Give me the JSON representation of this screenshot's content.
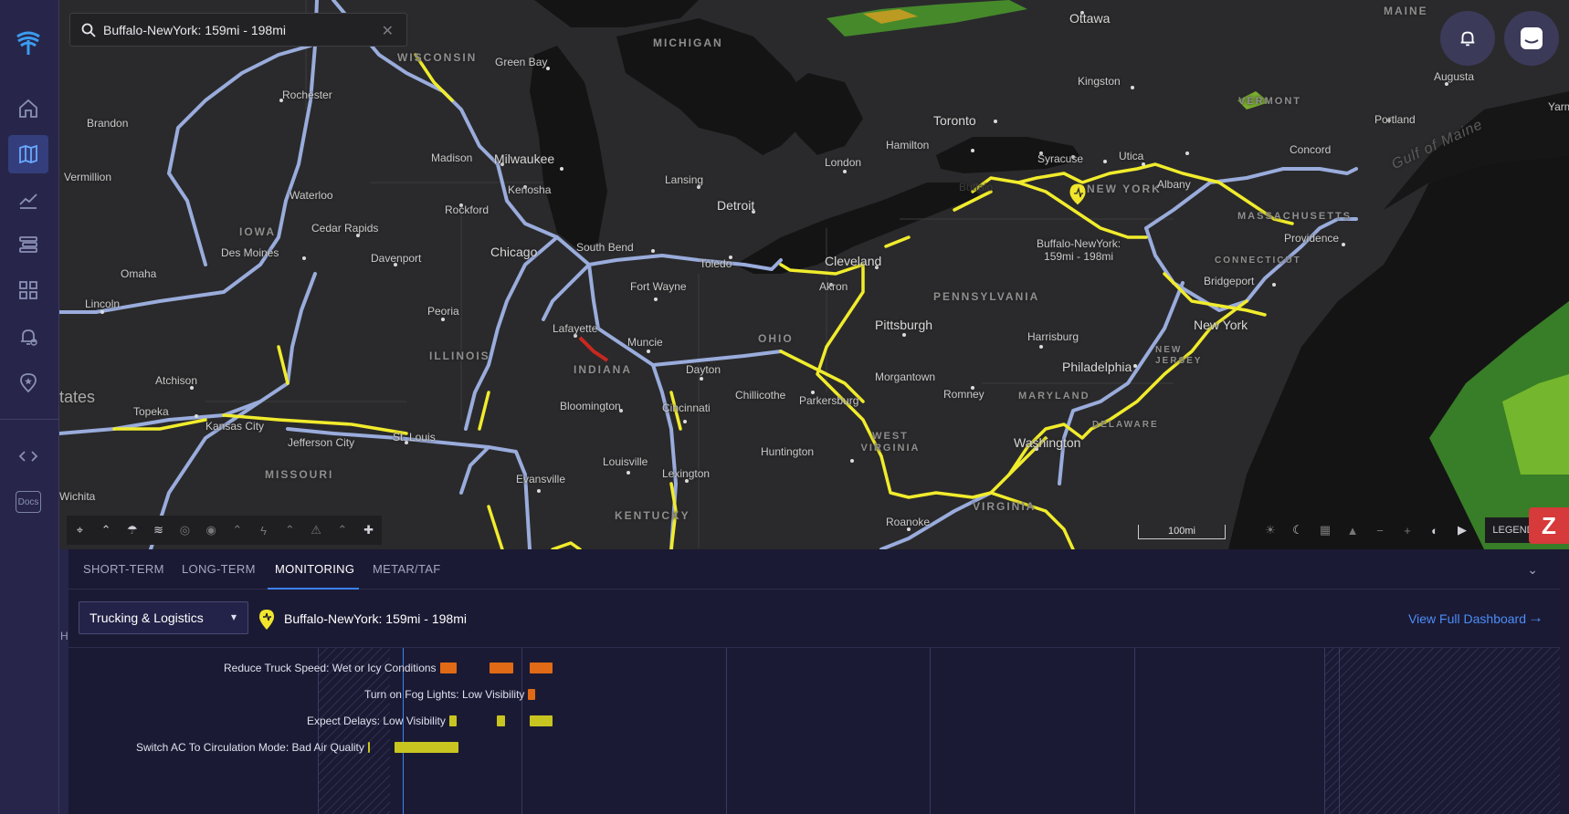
{
  "search": {
    "value": "Buffalo-NewYork: 159mi - 198mi"
  },
  "sidebar": {
    "items": [
      {
        "name": "home-icon"
      },
      {
        "name": "map-icon",
        "active": true
      },
      {
        "name": "chart-icon"
      },
      {
        "name": "layers-icon"
      },
      {
        "name": "dashboard-icon"
      },
      {
        "name": "alert-settings-icon"
      },
      {
        "name": "location-star-icon"
      },
      {
        "name": "code-icon"
      }
    ],
    "docs_label": "Docs"
  },
  "map": {
    "labels": {
      "states": [
        "WISCONSIN",
        "MICHIGAN",
        "IOWA",
        "ILLINOIS",
        "INDIANA",
        "OHIO",
        "PENNSYLVANIA",
        "NEW YORK",
        "MASSACHUSETTS",
        "CONNECTICUT",
        "NEW JERSEY",
        "MARYLAND",
        "DELAWARE",
        "WEST VIRGINIA",
        "VIRGINIA",
        "KENTUCKY",
        "MISSOURI",
        "VERMONT",
        "MAINE"
      ],
      "cities": [
        "Ottawa",
        "Green Bay",
        "Kingston",
        "Augusta",
        "Portland",
        "Rochester",
        "Brandon",
        "Vermillion",
        "Madison",
        "Milwaukee",
        "Toronto",
        "Hamilton",
        "Concord",
        "Kenosha",
        "London",
        "Lansing",
        "Syracuse",
        "Utica",
        "Albany",
        "Waterloo",
        "Rockford",
        "Detroit",
        "Buffalo",
        "Cedar Rapids",
        "Des Moines",
        "Omaha",
        "Davenport",
        "Chicago",
        "South Bend",
        "Toledo",
        "Cleveland",
        "Providence",
        "Fort Wayne",
        "Akron",
        "Bridgeport",
        "Lincoln",
        "Peoria",
        "Lafayette",
        "Muncie",
        "Pittsburgh",
        "New York",
        "Harrisburg",
        "Philadelphia",
        "Dayton",
        "Atchison",
        "Morgantown",
        "Chillicothe",
        "Parkersburg",
        "Romney",
        "Topeka",
        "Bloomington",
        "Cincinnati",
        "Kansas City",
        "St. Louis",
        "Jefferson City",
        "Huntington",
        "Washington",
        "Louisville",
        "Lexington",
        "Evansville",
        "Roanoke",
        "Wichita",
        "Yarm"
      ],
      "country_fragment": "tates",
      "water": "Gulf of Maine",
      "marker_label": [
        "Buffalo-NewYork:",
        "159mi - 198mi"
      ]
    },
    "scale_label": "100mi",
    "legend_label": "LEGEND"
  },
  "panel": {
    "tabs": [
      "SHORT-TERM",
      "LONG-TERM",
      "MONITORING",
      "METAR/TAF"
    ],
    "active_tab": "MONITORING",
    "industry_select": "Trucking & Logistics",
    "location_name": "Buffalo-NewYork: 159mi - 198mi",
    "dashboard_link": "View Full Dashboard",
    "timeline": [
      {
        "label": "Reduce Truck Speed: Wet or Icy Conditions",
        "color": "#e06a15",
        "segments": [
          [
            482,
            500
          ],
          [
            536,
            562
          ],
          [
            580,
            605
          ]
        ]
      },
      {
        "label": "Turn on Fog Lights: Low Visibility",
        "color": "#e06a15",
        "segments": [
          [
            578,
            586
          ]
        ]
      },
      {
        "label": "Expect Delays: Low Visibility",
        "color": "#c8c520",
        "segments": [
          [
            492,
            500
          ],
          [
            544,
            553
          ],
          [
            580,
            605
          ]
        ]
      },
      {
        "label": "Switch AC To Circulation Mode: Bad Air Quality",
        "color": "#c8c520",
        "segments": [
          [
            403,
            405
          ],
          [
            432,
            502
          ]
        ]
      }
    ]
  },
  "colors": {
    "accent": "#3b82f6",
    "highway": "#9aacdc",
    "alert_road": "#f1ec2c",
    "severe_road": "#c82820",
    "sidebar": "#27264a",
    "panel": "#1b1a34"
  }
}
